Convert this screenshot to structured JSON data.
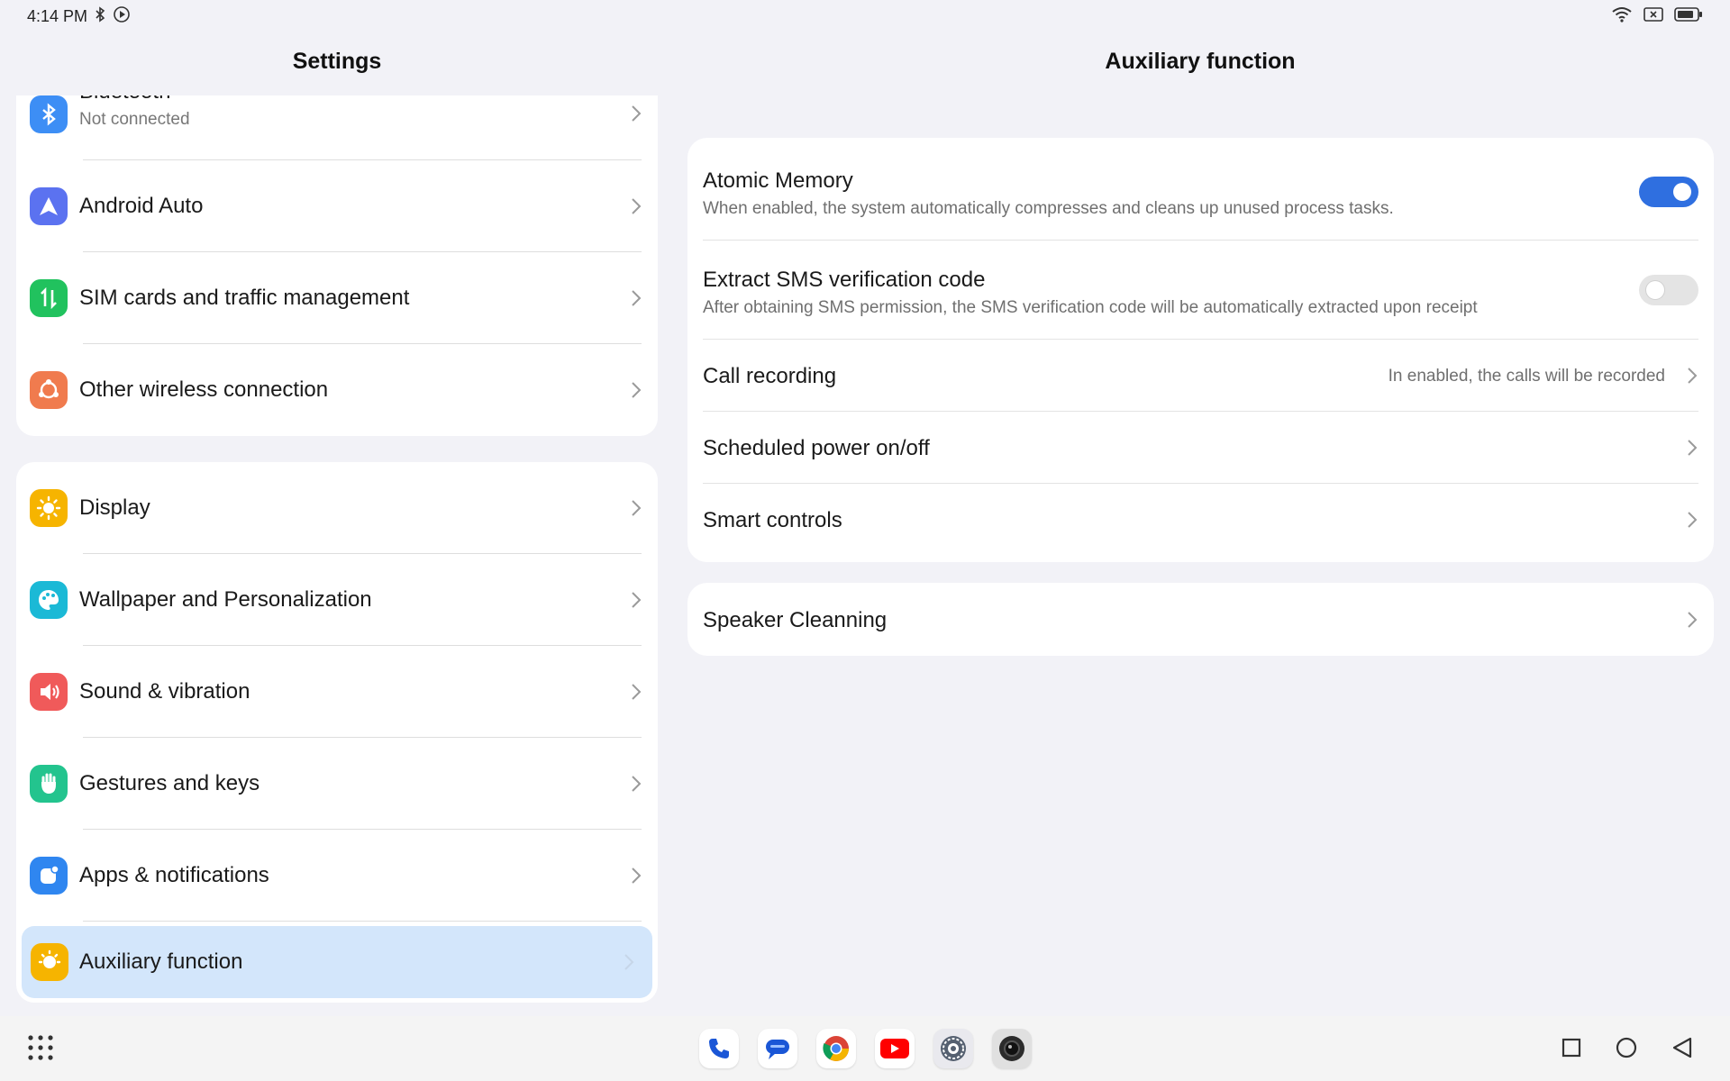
{
  "status_bar": {
    "time": "4:14 PM"
  },
  "left_pane": {
    "title": "Settings",
    "group1": [
      {
        "label": "Bluetooth",
        "sub": "Not connected",
        "icon": "bluetooth-icon",
        "color": "#3d8ef5"
      },
      {
        "label": "Android Auto",
        "icon": "android-auto-icon",
        "color": "#5b72f0"
      },
      {
        "label": "SIM cards and traffic management",
        "icon": "sim-traffic-icon",
        "color": "#21c25e"
      },
      {
        "label": "Other wireless connection",
        "icon": "wireless-icon",
        "color": "#f07b4e"
      }
    ],
    "group2": [
      {
        "label": "Display",
        "icon": "display-icon",
        "color": "#f6b400"
      },
      {
        "label": "Wallpaper and Personalization",
        "icon": "palette-icon",
        "color": "#1bb9d6"
      },
      {
        "label": "Sound & vibration",
        "icon": "sound-icon",
        "color": "#f05a5a"
      },
      {
        "label": "Gestures and keys",
        "icon": "hand-icon",
        "color": "#23c48e"
      },
      {
        "label": "Apps & notifications",
        "icon": "apps-icon",
        "color": "#2f86f0"
      },
      {
        "label": "Auxiliary function",
        "icon": "auxiliary-icon",
        "color": "#f6b400",
        "selected": true
      }
    ]
  },
  "right_pane": {
    "title": "Auxiliary function",
    "items": {
      "atomic_memory": {
        "title": "Atomic Memory",
        "desc": "When enabled, the system automatically compresses and cleans up unused process tasks.",
        "enabled": true
      },
      "sms_code": {
        "title": "Extract SMS verification code",
        "desc": "After obtaining SMS permission, the SMS verification code will be automatically extracted upon receipt",
        "enabled": false
      },
      "call_recording": {
        "title": "Call recording",
        "hint": "In enabled, the calls will be recorded"
      },
      "scheduled_power": {
        "title": "Scheduled power on/off"
      },
      "smart_controls": {
        "title": "Smart controls"
      },
      "speaker_cleaning": {
        "title": "Speaker Cleanning"
      }
    }
  },
  "taskbar": {
    "dock": [
      "phone-icon",
      "messages-icon",
      "chrome-icon",
      "youtube-icon",
      "settings-icon",
      "camera-icon"
    ],
    "nav": [
      "recents-icon",
      "home-icon",
      "back-icon"
    ]
  },
  "colors": {
    "accent": "#2f6fe0",
    "selected_bg": "#d3e6fb",
    "background": "#f2f2f7"
  }
}
